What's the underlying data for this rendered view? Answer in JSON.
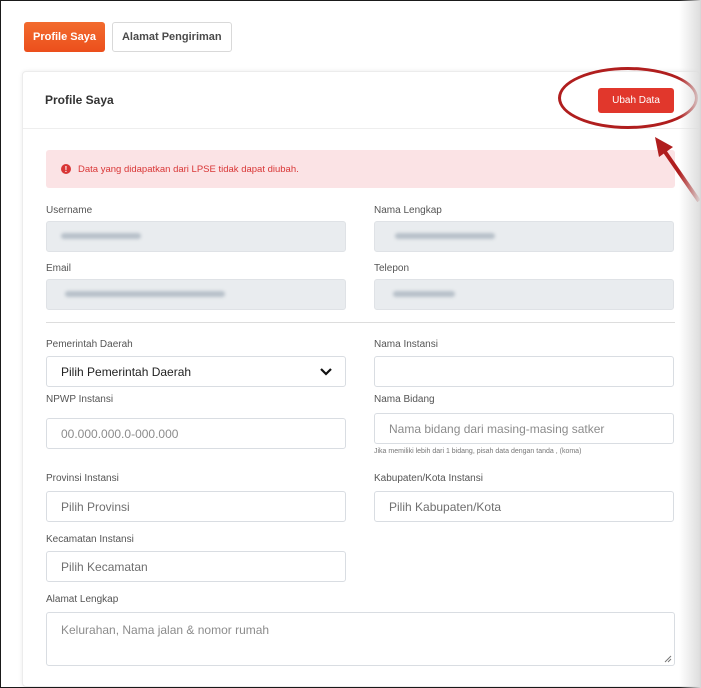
{
  "tabs": [
    {
      "label": "Profile Saya",
      "active": true
    },
    {
      "label": "Alamat Pengiriman",
      "active": false
    }
  ],
  "card": {
    "title": "Profile Saya",
    "edit_button": "Ubah Data"
  },
  "alert": {
    "icon": "exclamation-icon",
    "text": "Data yang didapatkan dari LPSE tidak dapat diubah."
  },
  "fields": {
    "username": {
      "label": "Username"
    },
    "nama_lengkap": {
      "label": "Nama Lengkap"
    },
    "email": {
      "label": "Email"
    },
    "telepon": {
      "label": "Telepon"
    },
    "pemerintah_daerah": {
      "label": "Pemerintah Daerah",
      "value": "Pilih Pemerintah Daerah"
    },
    "nama_instansi": {
      "label": "Nama Instansi",
      "value": ""
    },
    "npwp_instansi": {
      "label": "NPWP Instansi",
      "placeholder": "00.000.000.0-000.000"
    },
    "nama_bidang": {
      "label": "Nama Bidang",
      "placeholder": "Nama bidang dari masing-masing satker",
      "hint": "Jika memiliki lebih dari 1 bidang, pisah data dengan tanda , (koma)"
    },
    "provinsi_instansi": {
      "label": "Provinsi Instansi",
      "value": "Pilih Provinsi"
    },
    "kabupaten_kota_instansi": {
      "label": "Kabupaten/Kota Instansi",
      "value": "Pilih Kabupaten/Kota"
    },
    "kecamatan_instansi": {
      "label": "Kecamatan Instansi",
      "value": "Pilih Kecamatan"
    },
    "alamat_lengkap": {
      "label": "Alamat Lengkap",
      "placeholder": "Kelurahan, Nama jalan & nomor rumah"
    }
  },
  "colors": {
    "tab_active": "#ec4f1c",
    "edit_button": "#e1372c",
    "alert_bg": "#fbe3e5",
    "alert_text": "#d93636",
    "annotation": "#b01e1e"
  }
}
